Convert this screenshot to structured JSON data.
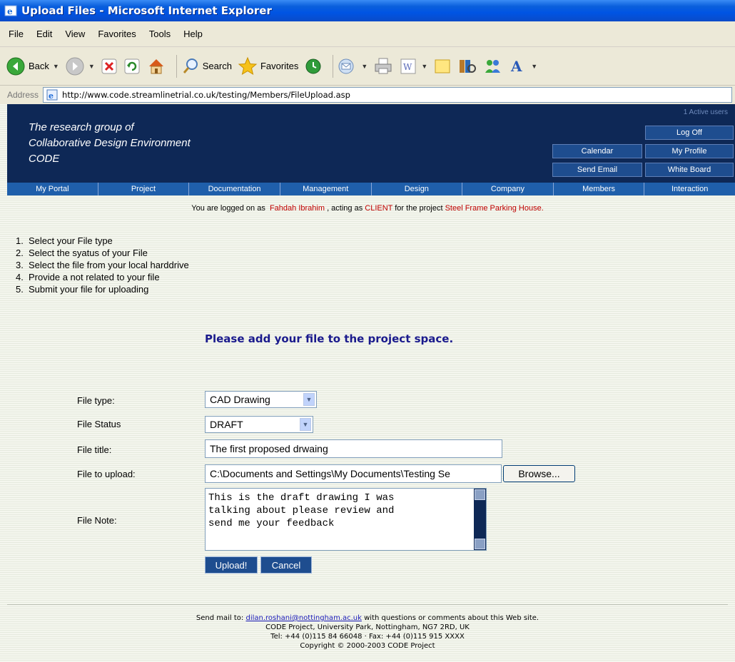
{
  "window": {
    "title": "Upload Files - Microsoft Internet Explorer"
  },
  "menu": [
    "File",
    "Edit",
    "View",
    "Favorites",
    "Tools",
    "Help"
  ],
  "toolbar": {
    "back": "Back",
    "search": "Search",
    "favorites": "Favorites"
  },
  "address": {
    "label": "Address",
    "url": "http://www.code.streamlinetrial.co.uk/testing/Members/FileUpload.asp"
  },
  "banner": {
    "line1": "The research group of",
    "line2": "Collaborative Design Environment",
    "line3": "CODE",
    "active_users": "1 Active users",
    "log_off": "Log Off",
    "calendar": "Calendar",
    "my_profile": "My Profile",
    "send_email": "Send Email",
    "white_board": "White Board"
  },
  "nav": [
    "My Portal",
    "Project",
    "Documentation",
    "Management",
    "Design",
    "Company",
    "Members",
    "Interaction"
  ],
  "logon": {
    "prefix": "You are logged on as",
    "user": "Fahdah  Ibrahim",
    "acting": ", acting as",
    "role": "CLIENT",
    "for": "for the project",
    "project": "Steel Frame Parking House."
  },
  "steps": [
    {
      "n": "1.",
      "text": "Select your File type"
    },
    {
      "n": "2.",
      "text": "Select the syatus of your File"
    },
    {
      "n": "3.",
      "text": "Select the file from your local harddrive"
    },
    {
      "n": "4.",
      "text": "Provide a not related to your file"
    },
    {
      "n": "5.",
      "text": "Submit your file for uploading"
    }
  ],
  "heading": "Please add your file to the project space.",
  "form": {
    "file_type_label": "File type:",
    "file_type_value": "CAD Drawing",
    "file_status_label": "File Status",
    "file_status_value": "DRAFT",
    "file_title_label": "File title:",
    "file_title_value": "The first proposed drwaing",
    "file_upload_label": "File to upload:",
    "file_upload_value": "C:\\Documents and Settings\\My Documents\\Testing Se",
    "browse_label": "Browse...",
    "file_note_label": "File Note:",
    "file_note_value": "This is the draft drawing I was\ntalking about please review and\nsend me your feedback",
    "upload_label": "Upload!",
    "cancel_label": "Cancel"
  },
  "footer": {
    "line1_prefix": "Send mail to:",
    "email": "dilan.roshani@nottingham.ac.uk",
    "line1_suffix": "with questions or comments about this Web site.",
    "line2": "CODE Project, University Park, Nottingham, NG7 2RD, UK",
    "line3": "Tel: +44 (0)115 84 66048 · Fax: +44 (0)115 915 XXXX",
    "line4": "Copyright © 2000-2003 CODE Project"
  },
  "icons": [
    "ie-icon",
    "back-icon",
    "forward-icon",
    "stop-icon",
    "refresh-icon",
    "home-icon",
    "search-icon",
    "favorites-star-icon",
    "history-icon",
    "mail-icon",
    "print-icon",
    "edit-word-icon",
    "folder-icon",
    "research-icon",
    "messenger-icon",
    "font-icon",
    "page-icon"
  ],
  "colors": {
    "banner": "#0e2856",
    "nav": "#1f5fab",
    "heading": "#1a1a8c",
    "highlight": "#c00000"
  }
}
